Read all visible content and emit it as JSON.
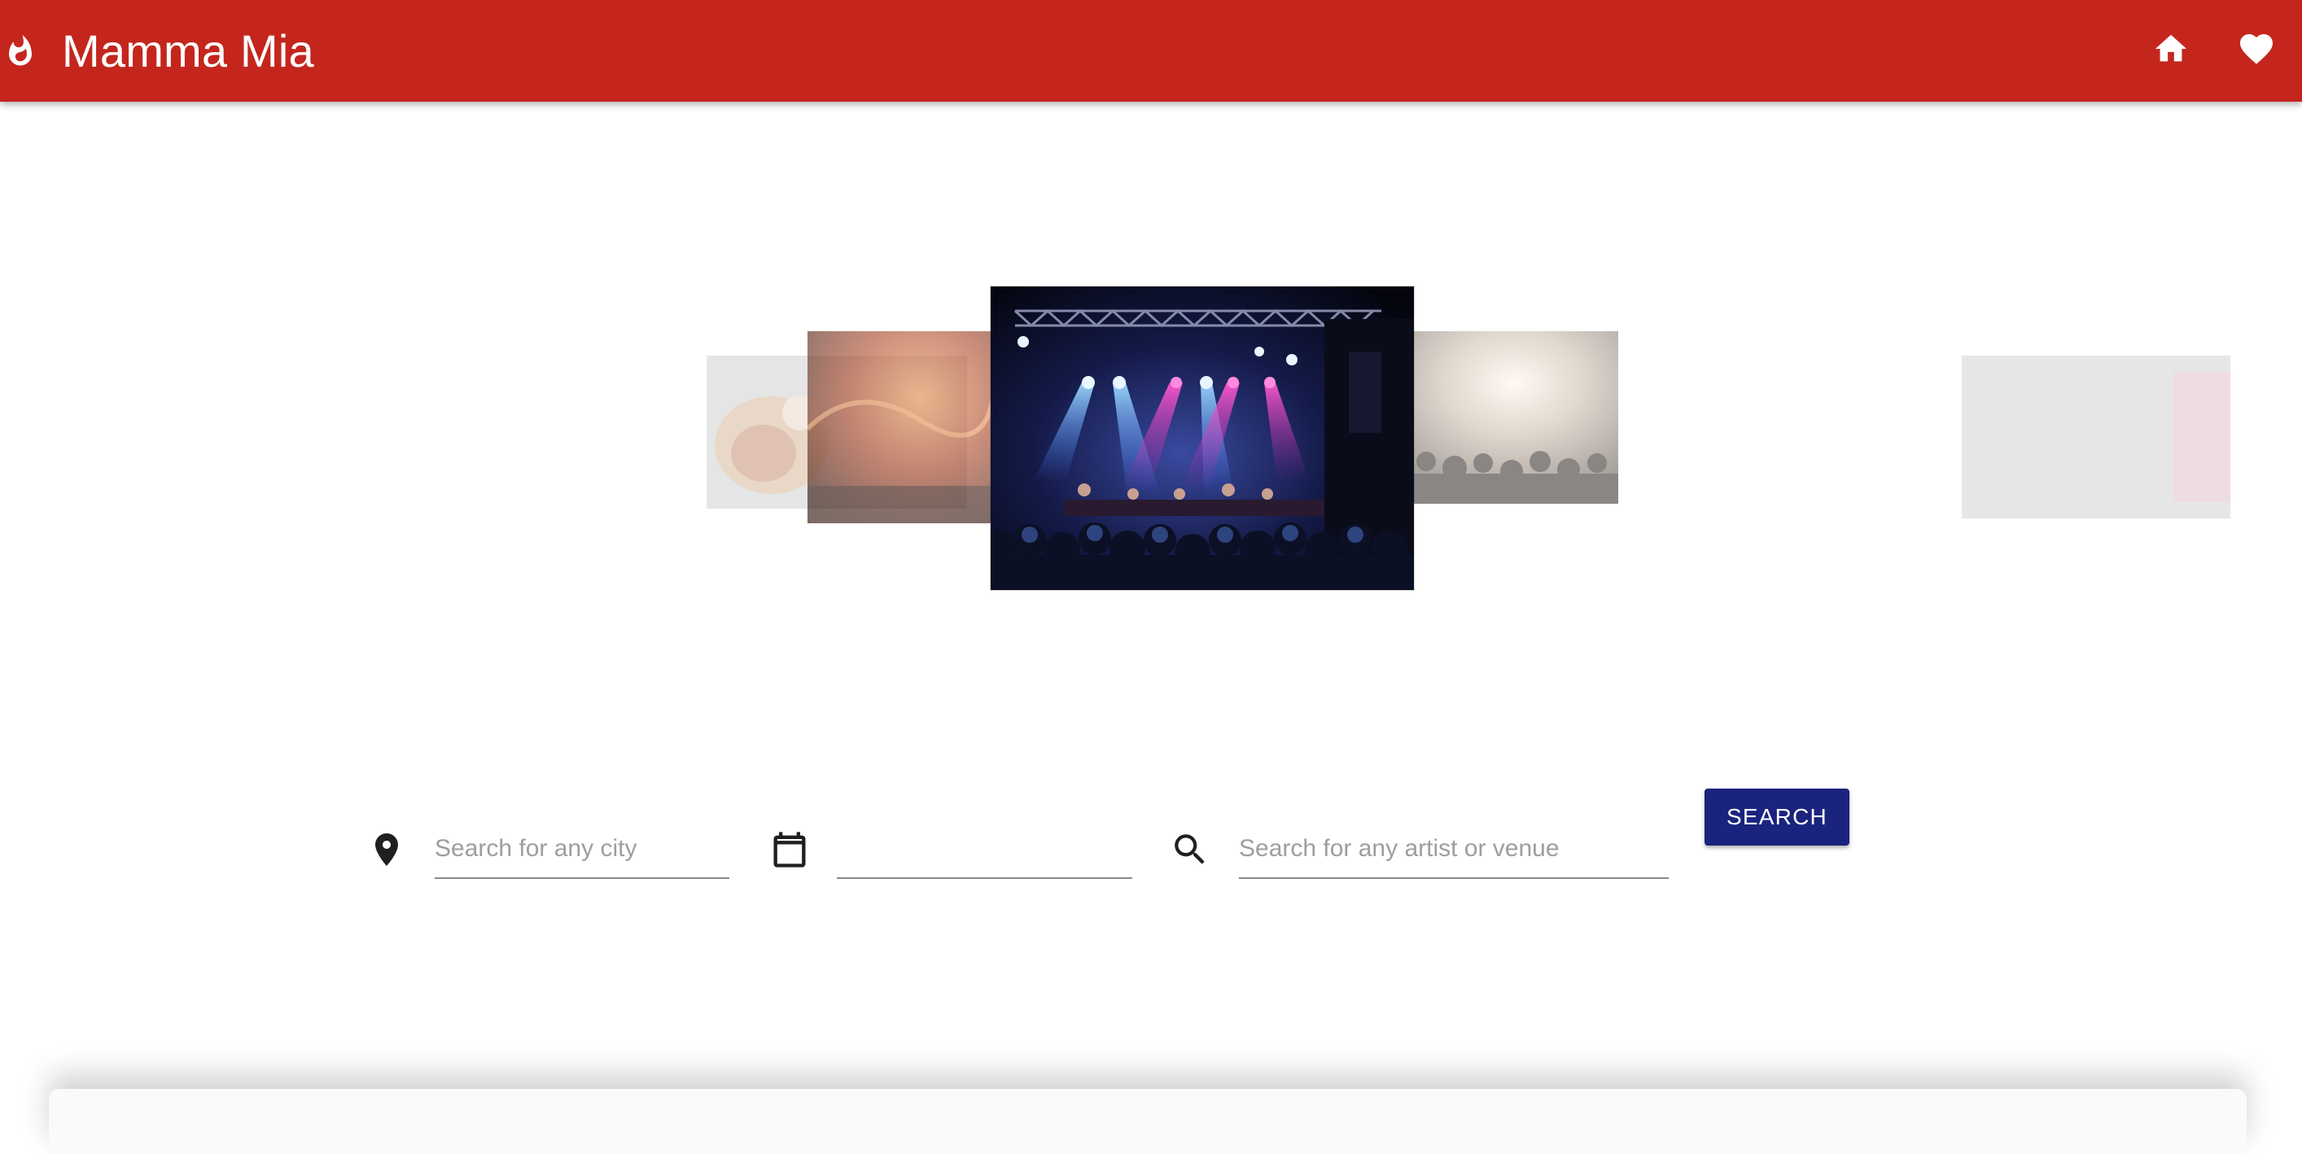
{
  "app": {
    "title": "Mamma Mia",
    "brand_icon": "whatshot-flame-icon",
    "bar_color": "#c4261d"
  },
  "nav": {
    "home_icon": "home-icon",
    "favorites_icon": "heart-icon"
  },
  "carousel": {
    "slides": [
      {
        "name": "carousel-slide-far-left",
        "subject": "warm-toned image"
      },
      {
        "name": "carousel-slide-left",
        "subject": "orange-lit concert"
      },
      {
        "name": "carousel-slide-active",
        "subject": "concert stage with blue and pink lights"
      },
      {
        "name": "carousel-slide-right",
        "subject": "crowd at concert"
      },
      {
        "name": "carousel-slide-far-right",
        "subject": "faded image"
      }
    ],
    "active_index": 2
  },
  "search": {
    "city_icon": "location-pin-icon",
    "city_placeholder": "Search for any city",
    "city_value": "",
    "date_icon": "calendar-icon",
    "date_placeholder": "",
    "date_value": "",
    "query_icon": "search-icon",
    "query_placeholder": "Search for any artist or venue",
    "query_value": "",
    "button_label": "SEARCH",
    "button_color": "#1a237e"
  }
}
